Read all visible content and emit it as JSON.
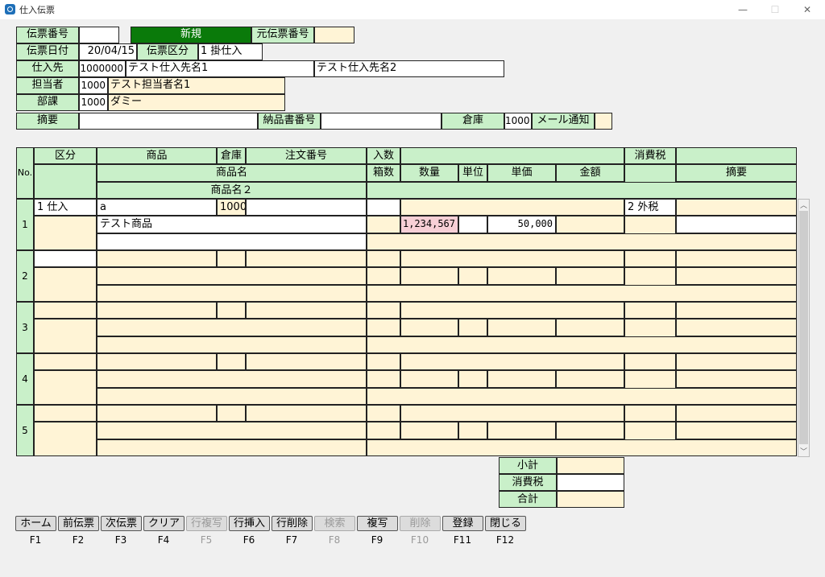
{
  "window": {
    "title": "仕入伝票",
    "min": "—",
    "max": "☐",
    "close": "✕"
  },
  "header": {
    "slip_no_label": "伝票番号",
    "slip_no": "",
    "status": "新規",
    "orig_slip_label": "元伝票番号",
    "orig_slip": "",
    "date_label": "伝票日付",
    "date": "20/04/15",
    "type_label": "伝票区分",
    "type": "1 掛仕入",
    "supplier_label": "仕入先",
    "supplier_code": "1000000",
    "supplier_name1": "テスト仕入先名1",
    "supplier_name2": "テスト仕入先名2",
    "staff_label": "担当者",
    "staff_code": "1000",
    "staff_name": "テスト担当者名1",
    "dept_label": "部課",
    "dept_code": "1000",
    "dept_name": "ダミー",
    "memo_label": "摘要",
    "memo": "",
    "delivery_label": "納品書番号",
    "delivery": "",
    "warehouse_label": "倉庫",
    "warehouse_code": "1000",
    "mail_label": "メール通知",
    "mail": ""
  },
  "grid": {
    "headers": {
      "no": "No.",
      "kubun": "区分",
      "shohin": "商品",
      "soko": "倉庫",
      "chumon": "注文番号",
      "irisu": "入数",
      "shohizei": "消費税",
      "shohinmei": "商品名",
      "hakosu": "箱数",
      "suryo": "数量",
      "tani": "単位",
      "tanka": "単価",
      "kingaku": "金額",
      "tekiyo": "摘要",
      "shohinmei2": "商品名２"
    },
    "rows": [
      {
        "no": "1",
        "kubun": "1 仕入",
        "shohin": "a",
        "soko": "1000",
        "name": "テスト商品",
        "quantity": "1,234,567",
        "price": "50,000",
        "tax": "2 外税"
      },
      {
        "no": "2"
      },
      {
        "no": "3"
      },
      {
        "no": "4"
      },
      {
        "no": "5"
      }
    ]
  },
  "totals": {
    "subtotal_label": "小計",
    "tax_label": "消費税",
    "total_label": "合計",
    "subtotal": "",
    "tax": "",
    "total": ""
  },
  "fkeys": [
    {
      "label": "ホーム",
      "key": "F1",
      "enabled": true
    },
    {
      "label": "前伝票",
      "key": "F2",
      "enabled": true
    },
    {
      "label": "次伝票",
      "key": "F3",
      "enabled": true
    },
    {
      "label": "クリア",
      "key": "F4",
      "enabled": true
    },
    {
      "label": "行複写",
      "key": "F5",
      "enabled": false
    },
    {
      "label": "行挿入",
      "key": "F6",
      "enabled": true
    },
    {
      "label": "行削除",
      "key": "F7",
      "enabled": true
    },
    {
      "label": "検索",
      "key": "F8",
      "enabled": false
    },
    {
      "label": "複写",
      "key": "F9",
      "enabled": true
    },
    {
      "label": "削除",
      "key": "F10",
      "enabled": false
    },
    {
      "label": "登録",
      "key": "F11",
      "enabled": true
    },
    {
      "label": "閉じる",
      "key": "F12",
      "enabled": true
    }
  ],
  "colors": {
    "label_bg": "#c9f0c9",
    "input_bg": "#fff4d6",
    "status_bg": "#0a7a0a",
    "highlight": "#f7cfd6"
  }
}
